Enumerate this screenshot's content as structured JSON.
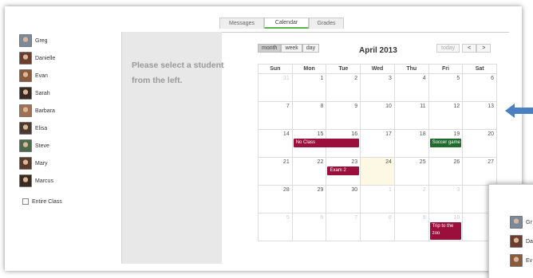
{
  "tabs": [
    {
      "label": "Messages"
    },
    {
      "label": "Calendar"
    },
    {
      "label": "Grades"
    }
  ],
  "students": [
    {
      "name": "Greg",
      "color": "#7a8a9a"
    },
    {
      "name": "Danielle",
      "color": "#6b3d2c"
    },
    {
      "name": "Evan",
      "color": "#8a5a3c"
    },
    {
      "name": "Sarah",
      "color": "#3a2a24"
    },
    {
      "name": "Barbara",
      "color": "#a07050"
    },
    {
      "name": "Elisa",
      "color": "#4a3a30"
    },
    {
      "name": "Steve",
      "color": "#4a6a4a"
    },
    {
      "name": "Mary",
      "color": "#5a3a2a"
    },
    {
      "name": "Marcus",
      "color": "#3a2a20"
    }
  ],
  "entire_class_label": "Entire Class",
  "panel_message": "Please select a student from the left.",
  "calendar": {
    "views": [
      "month",
      "week",
      "day"
    ],
    "title": "April 2013",
    "today_label": "today",
    "prev_label": "<",
    "next_label": ">",
    "days_of_week": [
      "Sun",
      "Mon",
      "Tue",
      "Wed",
      "Thu",
      "Fri",
      "Sat"
    ],
    "weeks": [
      [
        {
          "n": "31",
          "o": true
        },
        {
          "n": "1"
        },
        {
          "n": "2"
        },
        {
          "n": "3"
        },
        {
          "n": "4"
        },
        {
          "n": "5"
        },
        {
          "n": "6"
        }
      ],
      [
        {
          "n": "7"
        },
        {
          "n": "8"
        },
        {
          "n": "9"
        },
        {
          "n": "10"
        },
        {
          "n": "11"
        },
        {
          "n": "12"
        },
        {
          "n": "13"
        }
      ],
      [
        {
          "n": "14"
        },
        {
          "n": "15"
        },
        {
          "n": "16"
        },
        {
          "n": "17"
        },
        {
          "n": "18"
        },
        {
          "n": "19"
        },
        {
          "n": "20"
        }
      ],
      [
        {
          "n": "21"
        },
        {
          "n": "22"
        },
        {
          "n": "23"
        },
        {
          "n": "24",
          "t": true
        },
        {
          "n": "25"
        },
        {
          "n": "26"
        },
        {
          "n": "27"
        }
      ],
      [
        {
          "n": "28"
        },
        {
          "n": "29"
        },
        {
          "n": "30"
        },
        {
          "n": "1",
          "o": true
        },
        {
          "n": "2",
          "o": true
        },
        {
          "n": "3",
          "o": true
        },
        {
          "n": "4",
          "o": true
        }
      ],
      [
        {
          "n": "5",
          "o": true
        },
        {
          "n": "6",
          "o": true
        },
        {
          "n": "7",
          "o": true
        },
        {
          "n": "8",
          "o": true
        },
        {
          "n": "9",
          "o": true
        },
        {
          "n": "10",
          "o": true
        },
        {
          "n": "11",
          "o": true
        }
      ]
    ],
    "events": [
      {
        "label": "No Class",
        "color": "#9b0f3c"
      },
      {
        "label": "Soccer game",
        "color": "#1e6b2c"
      },
      {
        "label": "Exam 2",
        "color": "#9b0f3c"
      },
      {
        "label": "Trip to the zoo",
        "color": "#9b0f3c"
      }
    ]
  },
  "overlay_students": [
    {
      "name": "Gr",
      "color": "#7a8a9a"
    },
    {
      "name": "Da",
      "color": "#6b3d2c"
    },
    {
      "name": "Ev",
      "color": "#8a5a3c"
    }
  ],
  "arrow_color": "#4a7fc1"
}
